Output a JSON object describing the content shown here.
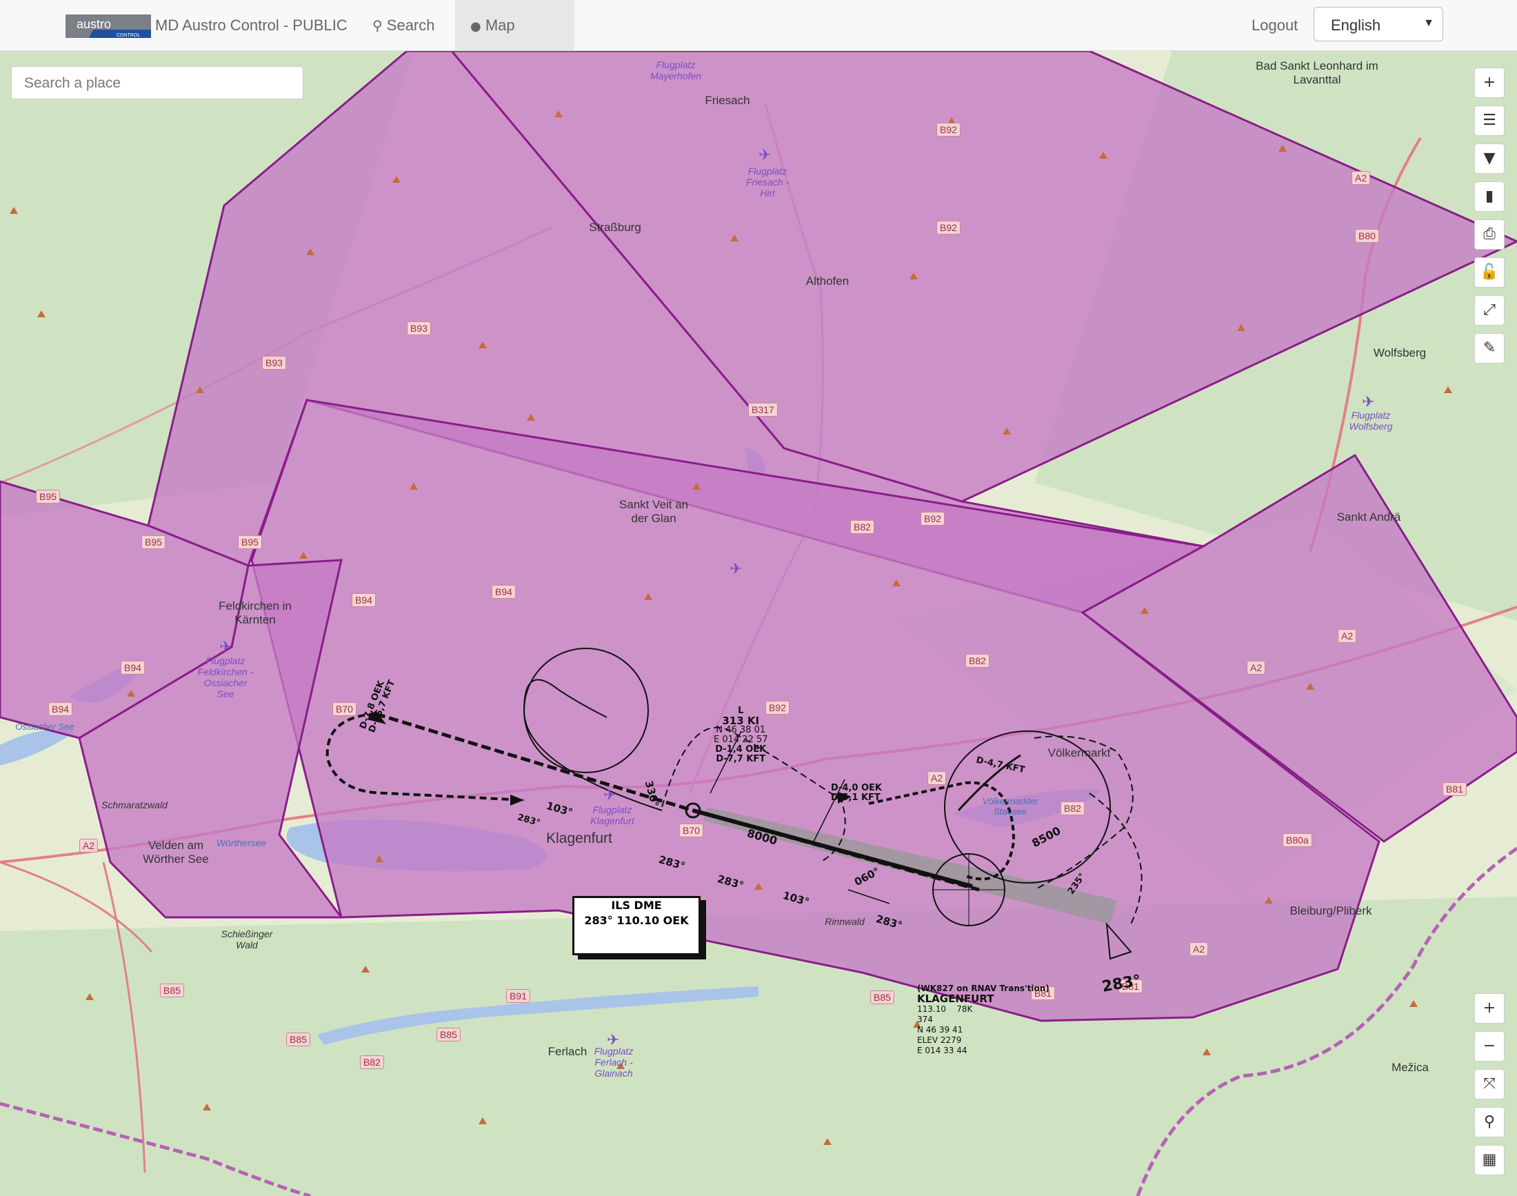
{
  "app": {
    "logo_text": "austro",
    "logo_subtext": "CONTROL",
    "title": "MD Austro Control - PUBLIC"
  },
  "nav": {
    "search_label": "Search",
    "map_label": "Map",
    "logout_label": "Logout",
    "language": "English"
  },
  "map": {
    "search_placeholder": "Search a place",
    "controls_top": [
      {
        "name": "zoom-in-button",
        "icon": "plus-icon",
        "glyph": "+"
      },
      {
        "name": "layers-button",
        "icon": "layers-icon",
        "glyph": "☰"
      },
      {
        "name": "filter-button",
        "icon": "filter-icon",
        "glyph": "▼"
      },
      {
        "name": "book-button",
        "icon": "book-icon",
        "glyph": "▮"
      },
      {
        "name": "print-button",
        "icon": "print-icon",
        "glyph": "⎙"
      },
      {
        "name": "lock-button",
        "icon": "unlock-icon",
        "glyph": "🔓"
      },
      {
        "name": "fullscreen-button",
        "icon": "expand-icon",
        "glyph": "⤢"
      },
      {
        "name": "draw-button",
        "icon": "pencil-icon",
        "glyph": "✎"
      }
    ],
    "controls_bottom": [
      {
        "name": "zoom-in-bottom-button",
        "icon": "plus-icon",
        "glyph": "+"
      },
      {
        "name": "zoom-out-button",
        "icon": "minus-icon",
        "glyph": "−"
      },
      {
        "name": "extent-button",
        "icon": "extent-icon",
        "glyph": "⤧"
      },
      {
        "name": "locate-button",
        "icon": "location-pin-icon",
        "glyph": "⚲"
      },
      {
        "name": "grid-button",
        "icon": "grid-icon",
        "glyph": "▦"
      }
    ],
    "colors": {
      "airspace_fill": "#c57ac5",
      "airspace_stroke": "#8a1d8a",
      "base_land": "#e6ecd4",
      "forest": "#cfe3c2",
      "road": "#e47f8a",
      "water": "#a9c4e8",
      "border": "#b562b5"
    },
    "places": [
      {
        "name": "Friesach"
      },
      {
        "name": "Straßburg"
      },
      {
        "name": "Althofen"
      },
      {
        "name": "Bad Sankt Leonhard im Lavanttal"
      },
      {
        "name": "Wolfsberg"
      },
      {
        "name": "Sankt Veit an der Glan"
      },
      {
        "name": "Feldkirchen in Kärnten"
      },
      {
        "name": "Sankt Andrä"
      },
      {
        "name": "Klagenfurt"
      },
      {
        "name": "Völkermarkt"
      },
      {
        "name": "Velden am Wörther See"
      },
      {
        "name": "Bleiburg/Pliberk"
      },
      {
        "name": "Ferlach"
      },
      {
        "name": "Mežica"
      },
      {
        "name": "Schmaratzwald"
      },
      {
        "name": "Rinnwald"
      },
      {
        "name": "Schießinger Wald"
      },
      {
        "name": "Wörthersee"
      },
      {
        "name": "Ossiacher See"
      },
      {
        "name": "Völkermarkter Stausee"
      }
    ],
    "airfields": [
      "Flugplatz Mayerhofen",
      "Flugplatz Friesach - Hirt",
      "Flugplatz Wolfsberg",
      "Flugplatz Feldkirchen - Ossiacher See",
      "Flugplatz Klagenfurt",
      "Flugplatz Ferlach - Glainach"
    ],
    "roads": [
      "B92",
      "B92",
      "B93",
      "B93",
      "B95",
      "B95",
      "B317",
      "B82",
      "B92",
      "B94",
      "B94",
      "B94",
      "B94",
      "B95",
      "B82",
      "B70",
      "B70",
      "B92",
      "A2",
      "A2",
      "A2",
      "A2",
      "A2",
      "B82",
      "B80a",
      "B81",
      "B81",
      "B85",
      "B91",
      "B85",
      "B85",
      "B85",
      "B82",
      "B81",
      "A2",
      "B80"
    ],
    "chart_overlay": {
      "ils": [
        "ILS DME",
        "283° 110.10 OEK"
      ],
      "ndb": [
        "L",
        "313 KI",
        "N 46 38 01",
        "E 014 22 57",
        "D-1,4 OEK",
        "D-7,7 KFT"
      ],
      "fix_a": [
        "D-4,0 OEK",
        "D-5,1 KFT"
      ],
      "fix_b": [
        "D-7,8 OEK",
        "D-16,7 KFT"
      ],
      "fix_c": "D-4,7 KFT",
      "airport": [
        "(WK827 on RNAV Trans'tion)",
        "KLAGENFURT",
        "113.10",
        "78K",
        "374",
        "N 46 39 41",
        "ELEV 2279",
        "E 014 33 44"
      ],
      "bearings": [
        "103°",
        "283°",
        "283°",
        "283°",
        "103°",
        "283°",
        "060°",
        "330°",
        "235°",
        "283°"
      ],
      "altitudes": [
        "8000",
        "8500"
      ]
    }
  }
}
